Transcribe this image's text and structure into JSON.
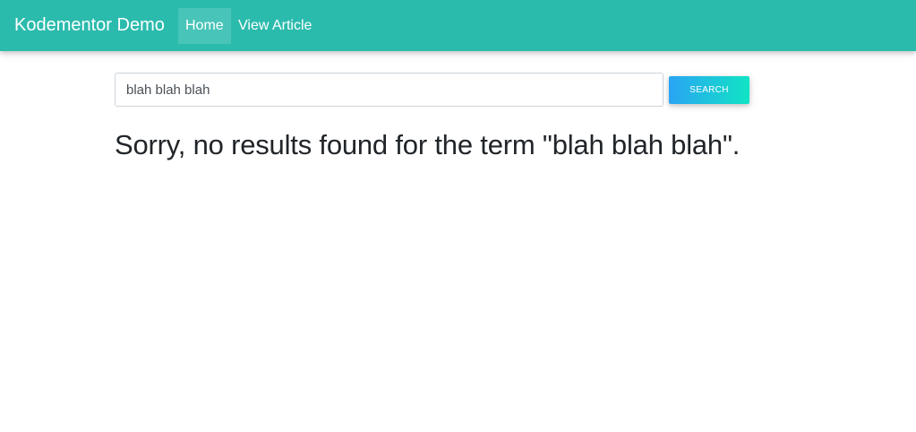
{
  "navbar": {
    "brand": "Kodementor Demo",
    "links": [
      {
        "label": "Home",
        "active": true
      },
      {
        "label": "View Article",
        "active": false
      }
    ],
    "color": "#2bbbad"
  },
  "search": {
    "value": "blah blah blah",
    "button_label": "SEARCH"
  },
  "result": {
    "prefix": "Sorry, no results found for the term \"",
    "term": "blah blah blah",
    "suffix": "\"."
  }
}
